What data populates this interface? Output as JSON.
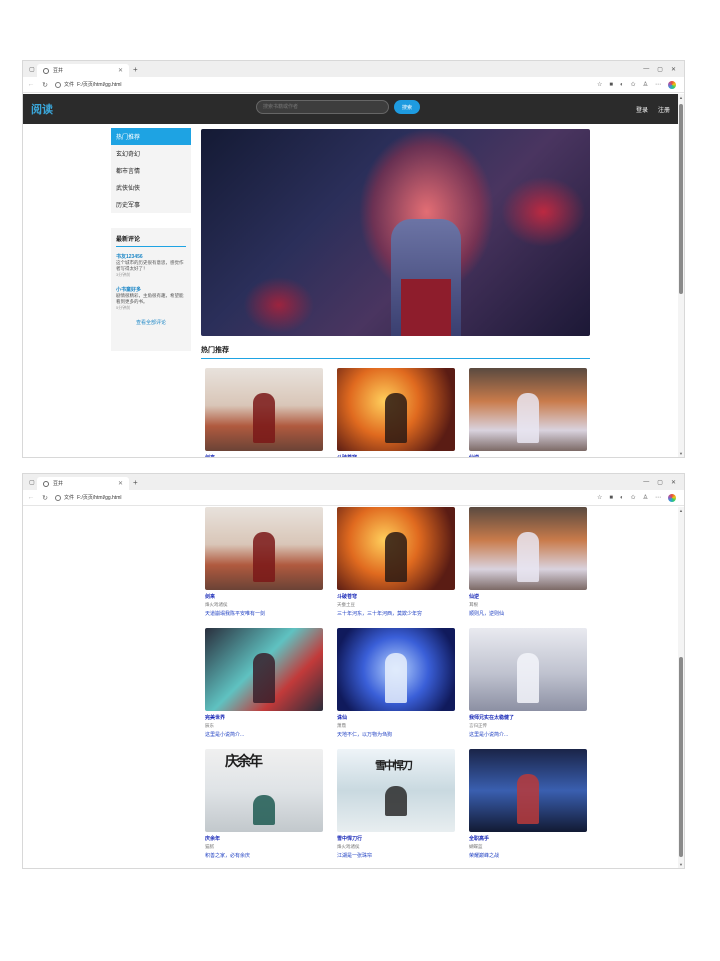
{
  "browser": {
    "tab_title": "豆井",
    "address_label": "文件",
    "url": "F:/页页/html/gg.html"
  },
  "site": {
    "logo": "阅读",
    "search_placeholder": "搜索书籍或作者",
    "search_button": "搜索",
    "login": "登录",
    "register": "注册"
  },
  "sidebar": {
    "categories": [
      "热门推荐",
      "玄幻奇幻",
      "都市言情",
      "武侠仙侠",
      "历史军事"
    ],
    "comments_title": "最新评论",
    "comments": [
      {
        "user": "书友123456",
        "text": "这个城市的历史很有意思，感觉作者写得太好了！",
        "time": "3分钟前"
      },
      {
        "user": "小书童好多",
        "text": "剧情很精彩，主角很有趣，希望能看到更多的书。",
        "time": "5分钟前"
      }
    ],
    "more_comments": "查看全部评论"
  },
  "section": {
    "hot_title": "热门推荐"
  },
  "books": [
    {
      "title": "剑来",
      "author": "烽火戏诸侯",
      "desc": "天道崩塌我陈平安唯有一剑"
    },
    {
      "title": "斗破苍穹",
      "author": "天蚕土豆",
      "desc": "三十年河东，三十年河西，莫欺少年穷"
    },
    {
      "title": "仙逆",
      "author": "耳根",
      "desc": "顺则凡，逆则仙"
    },
    {
      "title": "完美世界",
      "author": "辰东",
      "desc": "这里是小说简介..."
    },
    {
      "title": "诛仙",
      "author": "萧鼎",
      "desc": "天地不仁，以万物为刍狗"
    },
    {
      "title": "我师兄实在太稳健了",
      "author": "言归正传",
      "desc": "这里是小说简介..."
    },
    {
      "title": "庆余年",
      "author": "猫腻",
      "desc": "积善之家，必有余庆"
    },
    {
      "title": "雪中悍刀行",
      "author": "烽火戏诸侯",
      "desc": "江湖是一张珠帘"
    },
    {
      "title": "全职高手",
      "author": "蝴蝶蓝",
      "desc": "荣耀巅峰之战"
    }
  ],
  "cover_text": {
    "qingyunian": "庆余年",
    "xuezhong": "雪中悍刀"
  }
}
